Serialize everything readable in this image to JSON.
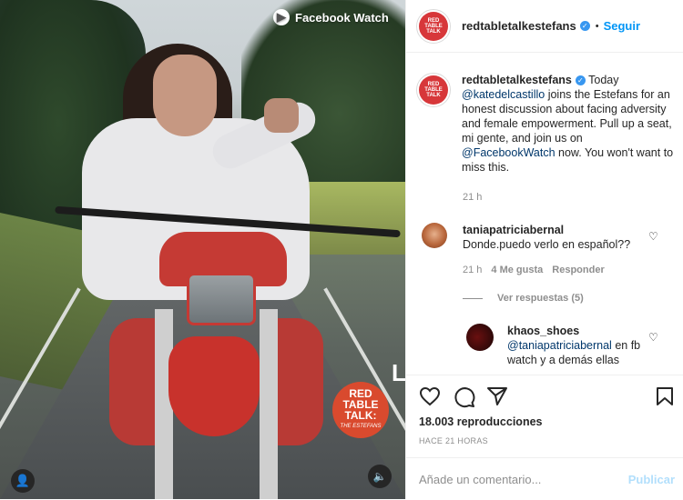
{
  "media": {
    "watermark": "Facebook Watch",
    "badge": {
      "line1": "RED",
      "line2": "TABLE",
      "line3": "TALK:",
      "line4": "THE ESTEFANS"
    },
    "cutoff_letter": "L"
  },
  "post": {
    "username": "redtabletalkestefans",
    "follow_label": "Seguir",
    "caption": {
      "username": "redtabletalkestefans",
      "part1": " Today ",
      "mention": "@katedelcastillo",
      "part2": " joins the Estefans for an honest discussion about facing adversity and female empowerment. Pull up a seat, mi gente, and join us on ",
      "link": "@FacebookWatch",
      "part3": " now. You won't want to miss this."
    },
    "caption_time": "21 h"
  },
  "comments": [
    {
      "username": "taniapatriciabernal",
      "text": "Donde.puedo verlo en español??",
      "time": "21 h",
      "likes": "4 Me gusta",
      "reply_label": "Responder",
      "view_replies": "Ver respuestas (5)"
    }
  ],
  "reply": {
    "username": "khaos_shoes",
    "mention": "@taniapatriciabernal",
    "text": " en fb watch y a demás ellas"
  },
  "stats": {
    "views": "18.003 reproducciones",
    "ago": "HACE 21 HORAS"
  },
  "composer": {
    "placeholder": "Añade un comentario...",
    "post_label": "Publicar"
  },
  "icons": {
    "heart": "heart-icon",
    "comment": "comment-icon",
    "share": "share-icon",
    "save": "bookmark-icon",
    "user": "user-tag-icon",
    "volume": "volume-icon"
  },
  "colors": {
    "link": "#00376b",
    "follow": "#0095f6",
    "verified": "#3897f0",
    "brand_red": "#d7373a"
  }
}
